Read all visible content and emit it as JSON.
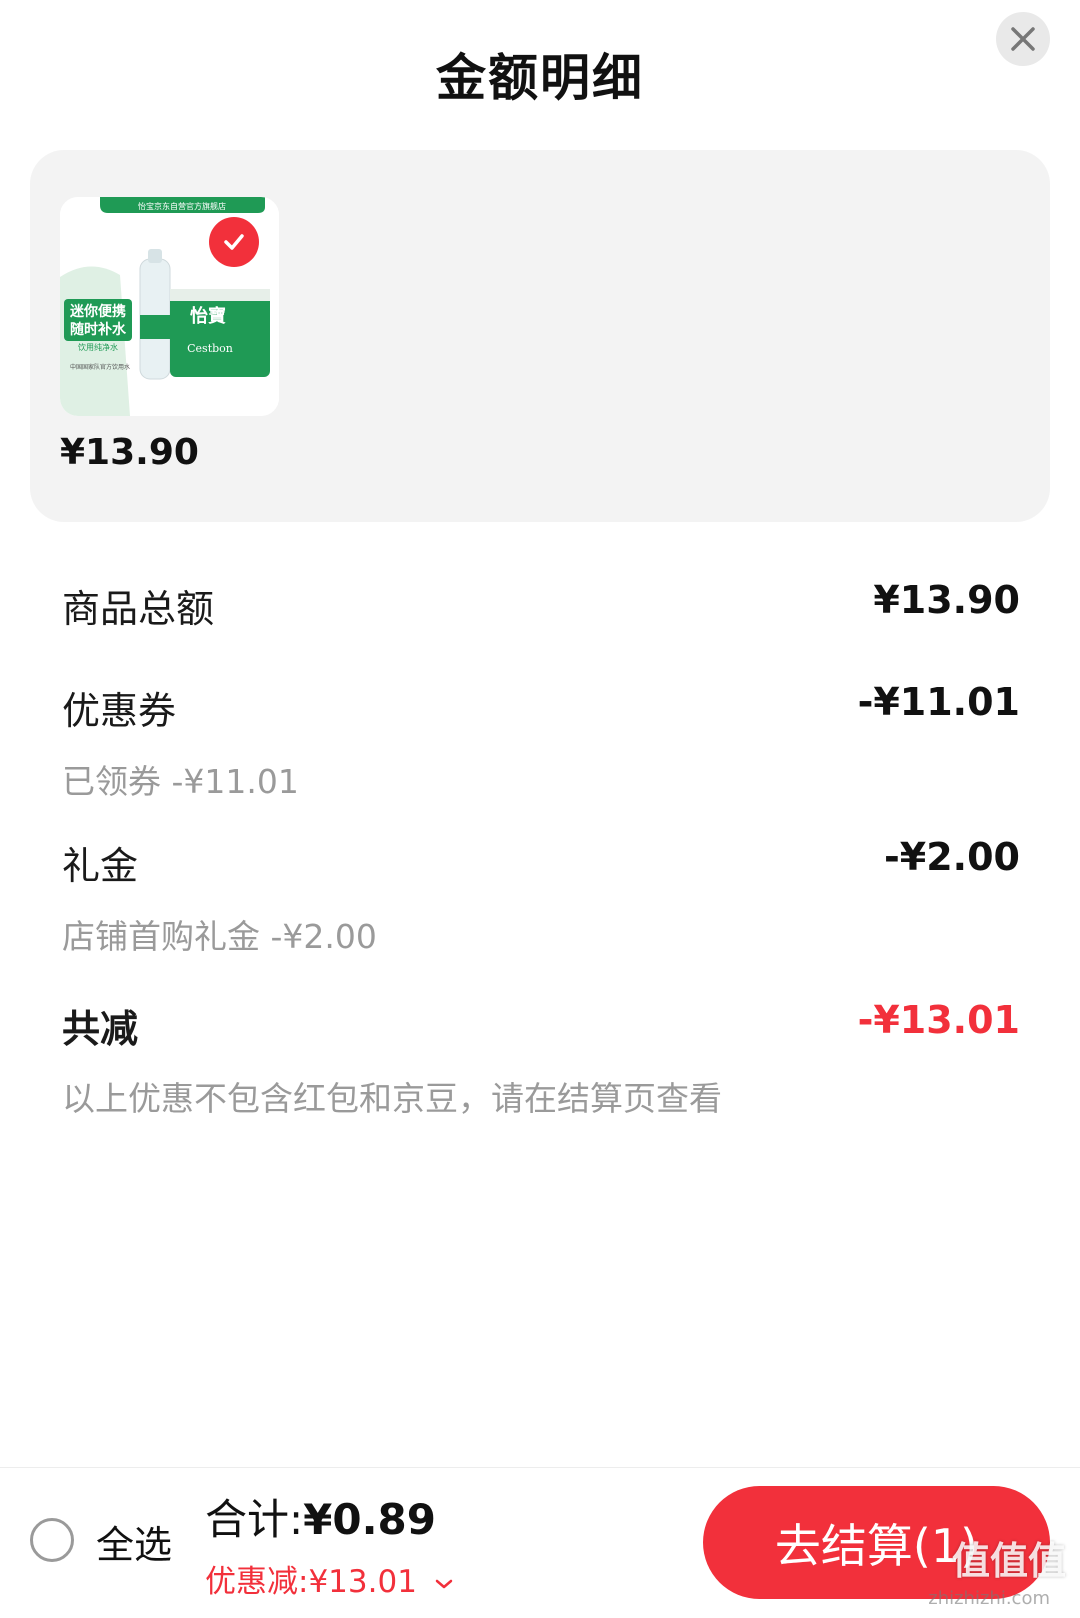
{
  "header": {
    "title": "金额明细"
  },
  "product": {
    "price": "¥13.90",
    "image_texts": {
      "store_banner": "怡宝京东自营官方旗舰店",
      "slogan_line1": "迷你便携",
      "slogan_line2": "随时补水",
      "product_type": "饮用纯净水",
      "brand": "怡寶",
      "brand_en": "Cestbon",
      "footer": "中国国家队官方饮用水"
    }
  },
  "breakdown": {
    "goods_total_label": "商品总额",
    "goods_total_value": "¥13.90",
    "coupon_label": "优惠券",
    "coupon_value": "-¥11.01",
    "coupon_sub": "已领券 -¥11.01",
    "gift_label": "礼金",
    "gift_value": "-¥2.00",
    "gift_sub": "店铺首购礼金 -¥2.00",
    "total_reduce_label": "共减",
    "total_reduce_value": "-¥13.01",
    "note": "以上优惠不包含红包和京豆，请在结算页查看"
  },
  "footer": {
    "select_all": "全选",
    "sum_label": "合计:",
    "sum_value": "¥0.89",
    "discount_label": "优惠减:",
    "discount_value": "¥13.01",
    "checkout": "去结算(1)"
  },
  "watermark": {
    "text": "值值值",
    "sub": "zhizhizhi.com"
  },
  "colors": {
    "accent": "#f2303b",
    "card_bg": "#f3f3f3",
    "muted_text": "#9a9a9a",
    "product_green": "#1f9a55"
  }
}
